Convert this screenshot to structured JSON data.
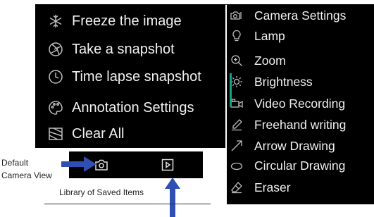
{
  "left_menu": {
    "items": [
      {
        "label": "Freeze the image",
        "icon": "snowflake-icon"
      },
      {
        "label": "Take a snapshot",
        "icon": "aperture-icon"
      },
      {
        "label": "Time lapse snapshot",
        "icon": "clock-icon"
      },
      {
        "label": "Annotation Settings",
        "icon": "palette-icon"
      },
      {
        "label": "Clear All",
        "icon": "eraser-box-icon"
      }
    ]
  },
  "bottom_toolbar": {
    "buttons": [
      {
        "icon": "camera-icon"
      },
      {
        "icon": "play-box-icon"
      }
    ]
  },
  "right_menu": {
    "items": [
      {
        "label": "Camera Settings",
        "icon": "camera-settings-icon"
      },
      {
        "label": "Lamp",
        "icon": "lightbulb-icon"
      },
      {
        "label": "Zoom",
        "icon": "zoom-in-icon"
      },
      {
        "label": "Brightness",
        "icon": "sun-icon"
      },
      {
        "label": "Video Recording",
        "icon": "video-camera-icon"
      },
      {
        "label": "Freehand writing",
        "icon": "pen-icon"
      },
      {
        "label": "Arrow Drawing",
        "icon": "arrow-icon"
      },
      {
        "label": "Circular Drawing",
        "icon": "ellipse-icon"
      },
      {
        "label": "Eraser",
        "icon": "eraser-icon"
      }
    ]
  },
  "annotations": {
    "default_camera_view_line1": "Default",
    "default_camera_view_line2": "Camera View",
    "library_saved_items": "Library of Saved Items"
  },
  "colors": {
    "panel_bg": "#000000",
    "text": "#f0f0f0",
    "icon": "#bdbdbd",
    "accent": "#16a085",
    "annotation_arrow": "#2f4fb5"
  }
}
